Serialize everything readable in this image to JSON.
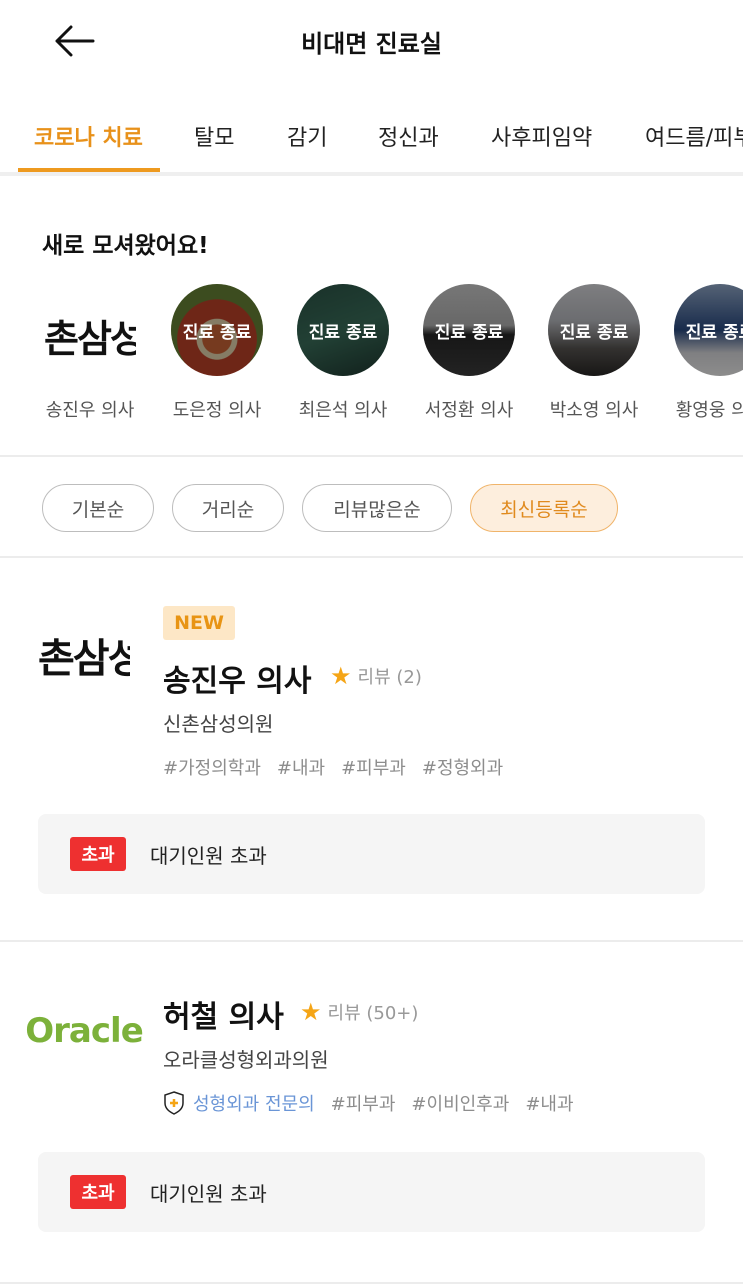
{
  "header": {
    "title": "비대면 진료실"
  },
  "tabs": [
    {
      "label": "코로나 치료"
    },
    {
      "label": "탈모"
    },
    {
      "label": "감기"
    },
    {
      "label": "정신과"
    },
    {
      "label": "사후피임약"
    },
    {
      "label": "여드름/피부"
    }
  ],
  "new_doctors": {
    "title": "새로 모셔왔어요!",
    "items": [
      {
        "name": "송진우 의사",
        "logo_text": "촌삼성",
        "status": ""
      },
      {
        "name": "도은정 의사",
        "status": "진료 종료"
      },
      {
        "name": "최은석 의사",
        "status": "진료 종료"
      },
      {
        "name": "서정환 의사",
        "status": "진료 종료"
      },
      {
        "name": "박소영 의사",
        "status": "진료 종료"
      },
      {
        "name": "황영웅 의사",
        "status": "진료 종료"
      }
    ]
  },
  "sort_options": [
    {
      "label": "기본순"
    },
    {
      "label": "거리순"
    },
    {
      "label": "리뷰많은순"
    },
    {
      "label": "최신등록순"
    }
  ],
  "cards": [
    {
      "badge": "NEW",
      "logo_text": "촌삼성",
      "doctor": "송진우 의사",
      "review": "리뷰 (2)",
      "clinic": "신촌삼성의원",
      "specialist": "",
      "tags": [
        "#가정의학과",
        "#내과",
        "#피부과",
        "#정형외과"
      ],
      "status_badge": "초과",
      "status_text": "대기인원 초과"
    },
    {
      "badge": "",
      "logo_text": "Oracle",
      "doctor": "허철 의사",
      "review": "리뷰 (50+)",
      "clinic": "오라클성형외과의원",
      "specialist": "성형외과 전문의",
      "tags": [
        "#피부과",
        "#이비인후과",
        "#내과"
      ],
      "status_badge": "초과",
      "status_text": "대기인원 초과"
    }
  ],
  "colors": {
    "accent": "#e8911a",
    "status_red": "#ee3030",
    "specialist_blue": "#6a95d6"
  }
}
